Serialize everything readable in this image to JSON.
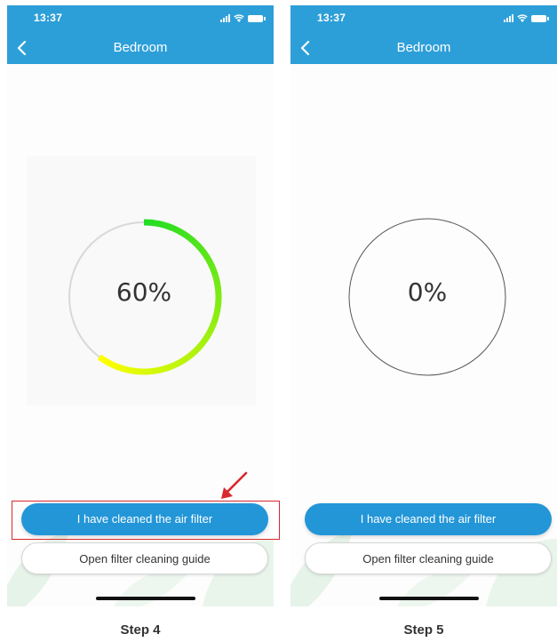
{
  "panels": [
    {
      "status_time": "13:37",
      "title": "Bedroom",
      "percent_label": "60%",
      "progress": 0.6,
      "primary_button": "I have cleaned the air filter",
      "secondary_button": "Open filter cleaning guide",
      "caption": "Step 4"
    },
    {
      "status_time": "13:37",
      "title": "Bedroom",
      "percent_label": "0%",
      "progress": 0,
      "primary_button": "I have cleaned the air filter",
      "secondary_button": "Open filter cleaning guide",
      "caption": "Step 5"
    }
  ],
  "colors": {
    "header": "#2d9fd8",
    "primary_button": "#2396d8",
    "ring_start": "#22dd22",
    "ring_end": "#ffff00",
    "ring_track": "#d8d8d8",
    "highlight": "#d9282f",
    "decor_leaf": "#e6f3e8"
  },
  "icons": {
    "back": "chevron-left-icon",
    "signal": "signal-icon",
    "wifi": "wifi-icon",
    "battery": "battery-icon",
    "annotation": "red-arrow-icon"
  }
}
